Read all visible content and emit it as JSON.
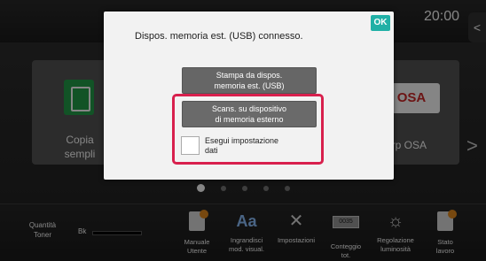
{
  "status": {
    "time": "20:00",
    "side_tab": "<"
  },
  "home": {
    "tile_left": {
      "label_line1": "Copia",
      "label_line2": "sempli"
    },
    "tile_right": {
      "logo": "OSA",
      "label": "arp OSA"
    },
    "arrow_right": ">",
    "page_dots": 5
  },
  "dialog": {
    "message": "Dispos. memoria est. (USB) connesso.",
    "ok_label": "OK",
    "print_btn": {
      "line1": "Stampa da dispos.",
      "line2": "memoria est. (USB)"
    },
    "scan_btn": {
      "line1": "Scans. su dispositivo",
      "line2": "di memoria esterno"
    },
    "checkbox": {
      "checked": false,
      "line1": "Esegui impostazione",
      "line2": "dati"
    },
    "highlight_color": "#d8204d"
  },
  "bottombar": {
    "toner": {
      "label_line1": "Quantità",
      "label_line2": "Toner",
      "color_label": "Bk"
    },
    "items": [
      {
        "icon": "manual-icon",
        "line1": "Manuale",
        "line2": "Utente"
      },
      {
        "icon": "text-size-icon",
        "line1": "Ingrandisci",
        "line2": "mod. visual."
      },
      {
        "icon": "tools-icon",
        "line1": "Impostazioni",
        "line2": ""
      },
      {
        "icon": "counter-icon",
        "counter_text": "0035",
        "line1": "Conteggio",
        "line2": "tot."
      },
      {
        "icon": "brightness-icon",
        "line1": "Regolazione",
        "line2": "luminosità"
      },
      {
        "icon": "job-status-icon",
        "line1": "Stato",
        "line2": "lavoro"
      }
    ]
  }
}
